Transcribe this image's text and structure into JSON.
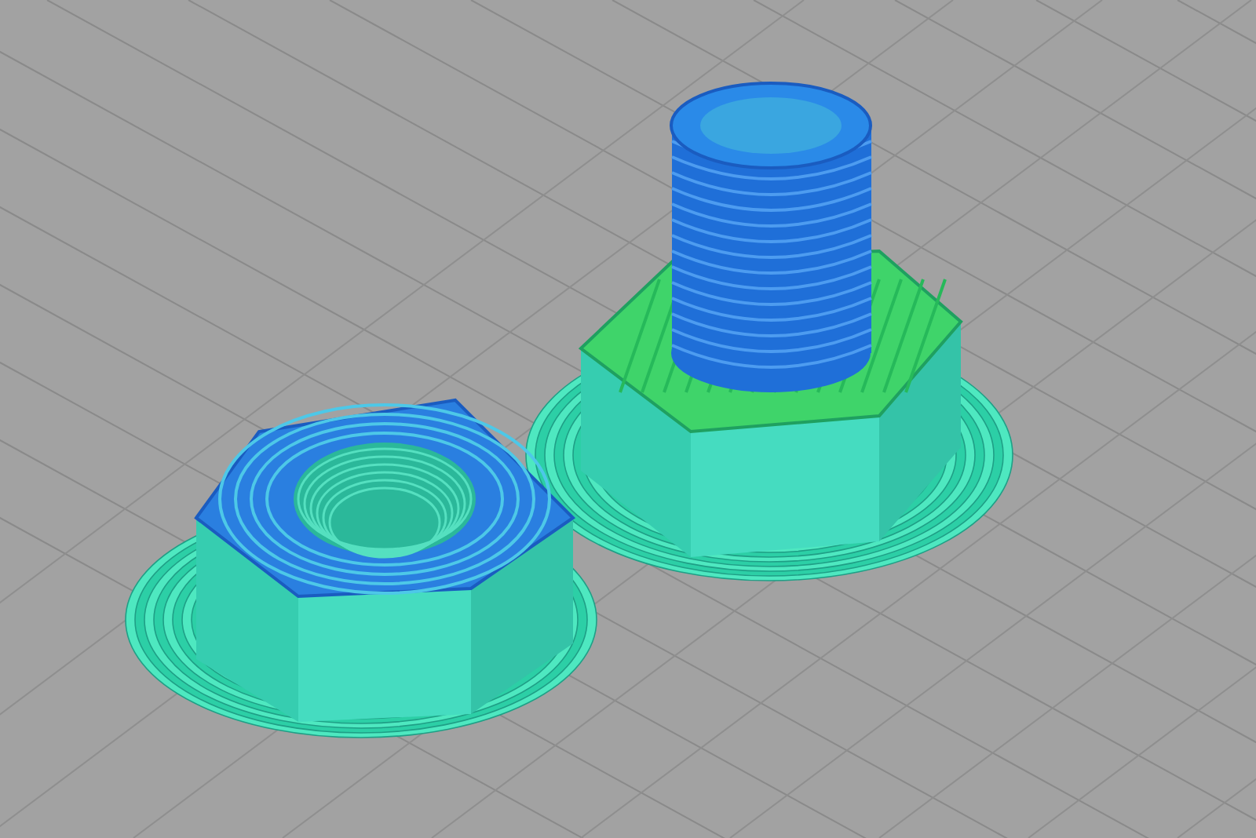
{
  "scene": {
    "kind": "print-preview"
  }
}
